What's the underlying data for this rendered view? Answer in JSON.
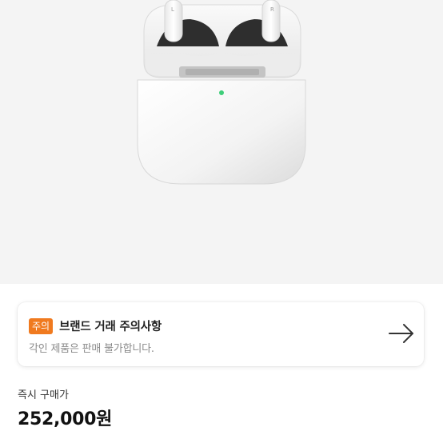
{
  "product": {
    "image_alt_icon": "airpods-case-image",
    "background": "#f4f4f4"
  },
  "notice": {
    "badge": "주의",
    "title": "브랜드 거래 주의사항",
    "subtitle": "각인 제품은 판매 불가합니다.",
    "arrow_icon": "arrow-right-icon",
    "badge_color": "#f07a1f"
  },
  "price": {
    "label": "즉시 구매가",
    "value": "252,000원"
  }
}
